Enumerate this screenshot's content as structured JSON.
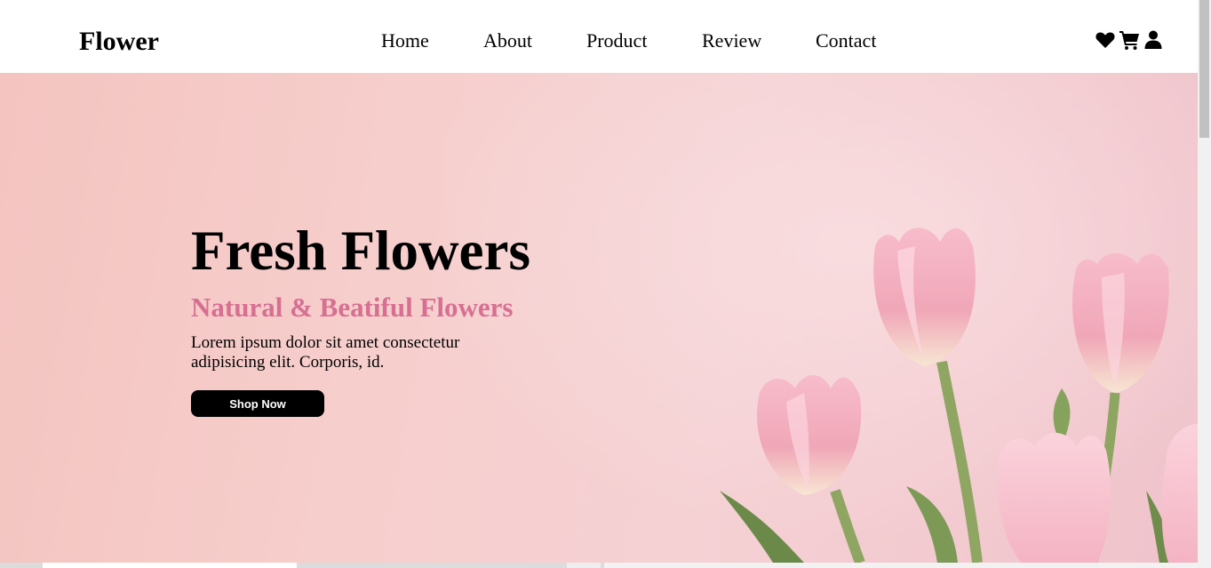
{
  "brand": {
    "logo_text": "Flower"
  },
  "nav": {
    "items": [
      {
        "label": "Home"
      },
      {
        "label": "About"
      },
      {
        "label": "Product"
      },
      {
        "label": "Review"
      },
      {
        "label": "Contact"
      }
    ]
  },
  "header_icons": [
    "heart-icon",
    "cart-icon",
    "user-icon"
  ],
  "hero": {
    "title": "Fresh Flowers",
    "subtitle": "Natural & Beatiful Flowers",
    "description": "Lorem ipsum dolor sit amet consectetur adipisicing elit. Corporis, id.",
    "cta_label": "Shop Now"
  },
  "colors": {
    "accent_pink": "#d76f93",
    "button_bg": "#000000",
    "hero_bg": "#f4c4c0",
    "tulip_pink": "#f3b1c0",
    "stem_green": "#8fa663"
  }
}
